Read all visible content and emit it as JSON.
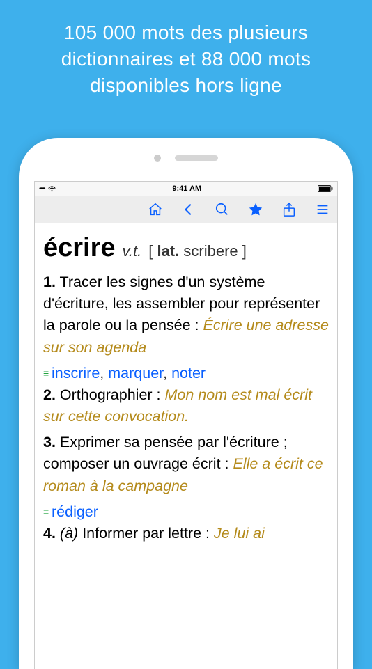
{
  "promo": "105 000 mots des plusieurs dictionnaires et 88 000 mots disponibles hors ligne",
  "status": {
    "time": "9:41 AM",
    "signal": "•••••"
  },
  "entry": {
    "headword": "écrire",
    "pos": "v.t.",
    "etym_open": "[ ",
    "etym_lang": "lat.",
    "etym_word": " scribere ]",
    "senses": [
      {
        "num": "1.",
        "def": "Tracer les signes d'un système d'écriture, les assembler pour représenter la parole ou la pensée :",
        "example": "Écrire une adresse sur son agenda",
        "syns": [
          "inscrire",
          "marquer",
          "noter"
        ]
      },
      {
        "num": "2.",
        "def": "Orthographier :",
        "example": "Mon nom est mal écrit sur cette convocation."
      },
      {
        "num": "3.",
        "def": "Exprimer sa pensée par l'écriture ; composer un ouvrage écrit :",
        "example": "Elle a écrit ce roman à la campagne",
        "syns": [
          "rédiger"
        ]
      },
      {
        "num": "4.",
        "marker": "(à)",
        "def": "Informer par lettre :",
        "example": "Je lui ai"
      }
    ]
  },
  "sep": ", "
}
